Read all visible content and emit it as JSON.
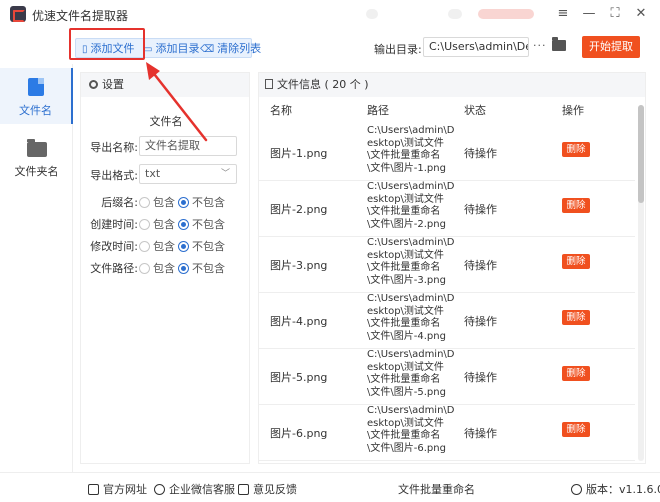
{
  "app": {
    "title": "优速文件名提取器"
  },
  "window_controls": {
    "menu": "≡",
    "minimize": "—",
    "maximize": "⛶",
    "close": "✕"
  },
  "toolbar": {
    "add_file": "添加文件",
    "add_folder": "添加目录",
    "clear_list": "清除列表",
    "output_label": "输出目录:",
    "output_path": "C:\\Users\\admin\\Deskto",
    "more": "···",
    "start": "开始提取"
  },
  "nav": {
    "items": [
      {
        "label": "文件名",
        "icon": "file-icon"
      },
      {
        "label": "文件夹名",
        "icon": "folder-icon"
      }
    ]
  },
  "settings": {
    "header": "设置",
    "section_title": "文件名",
    "export_name_label": "导出名称:",
    "export_name_value": "文件名提取",
    "export_format_label": "导出格式:",
    "export_format_value": "txt",
    "rows": [
      {
        "label": "后缀名:",
        "opt1": "包含",
        "opt2": "不包含"
      },
      {
        "label": "创建时间:",
        "opt1": "包含",
        "opt2": "不包含"
      },
      {
        "label": "修改时间:",
        "opt1": "包含",
        "opt2": "不包含"
      },
      {
        "label": "文件路径:",
        "opt1": "包含",
        "opt2": "不包含"
      }
    ]
  },
  "files": {
    "header": "文件信息 ( 20 个 )",
    "columns": {
      "name": "名称",
      "path": "路径",
      "status": "状态",
      "action": "操作"
    },
    "rows": [
      {
        "name": "图片-1.png",
        "path": [
          "C:\\Users\\admin\\D",
          "esktop\\测试文件",
          "\\文件批量重命名",
          "\\文件\\图片-1.png"
        ],
        "status": "待操作",
        "action": "删除"
      },
      {
        "name": "图片-2.png",
        "path": [
          "C:\\Users\\admin\\D",
          "esktop\\测试文件",
          "\\文件批量重命名",
          "\\文件\\图片-2.png"
        ],
        "status": "待操作",
        "action": "删除"
      },
      {
        "name": "图片-3.png",
        "path": [
          "C:\\Users\\admin\\D",
          "esktop\\测试文件",
          "\\文件批量重命名",
          "\\文件\\图片-3.png"
        ],
        "status": "待操作",
        "action": "删除"
      },
      {
        "name": "图片-4.png",
        "path": [
          "C:\\Users\\admin\\D",
          "esktop\\测试文件",
          "\\文件批量重命名",
          "\\文件\\图片-4.png"
        ],
        "status": "待操作",
        "action": "删除"
      },
      {
        "name": "图片-5.png",
        "path": [
          "C:\\Users\\admin\\D",
          "esktop\\测试文件",
          "\\文件批量重命名",
          "\\文件\\图片-5.png"
        ],
        "status": "待操作",
        "action": "删除"
      },
      {
        "name": "图片-6.png",
        "path": [
          "C:\\Users\\admin\\D",
          "esktop\\测试文件",
          "\\文件批量重命名",
          "\\文件\\图片-6.png"
        ],
        "status": "待操作",
        "action": "删除"
      }
    ]
  },
  "footer": {
    "website": "官方网址",
    "wechat": "企业微信客服",
    "feedback": "意见反馈",
    "promo": "文件批量重命名",
    "version": "版本：v1.1.6.0"
  },
  "colors": {
    "accent": "#2c6fcf",
    "danger": "#f0501f",
    "highlight": "#e5322d"
  }
}
